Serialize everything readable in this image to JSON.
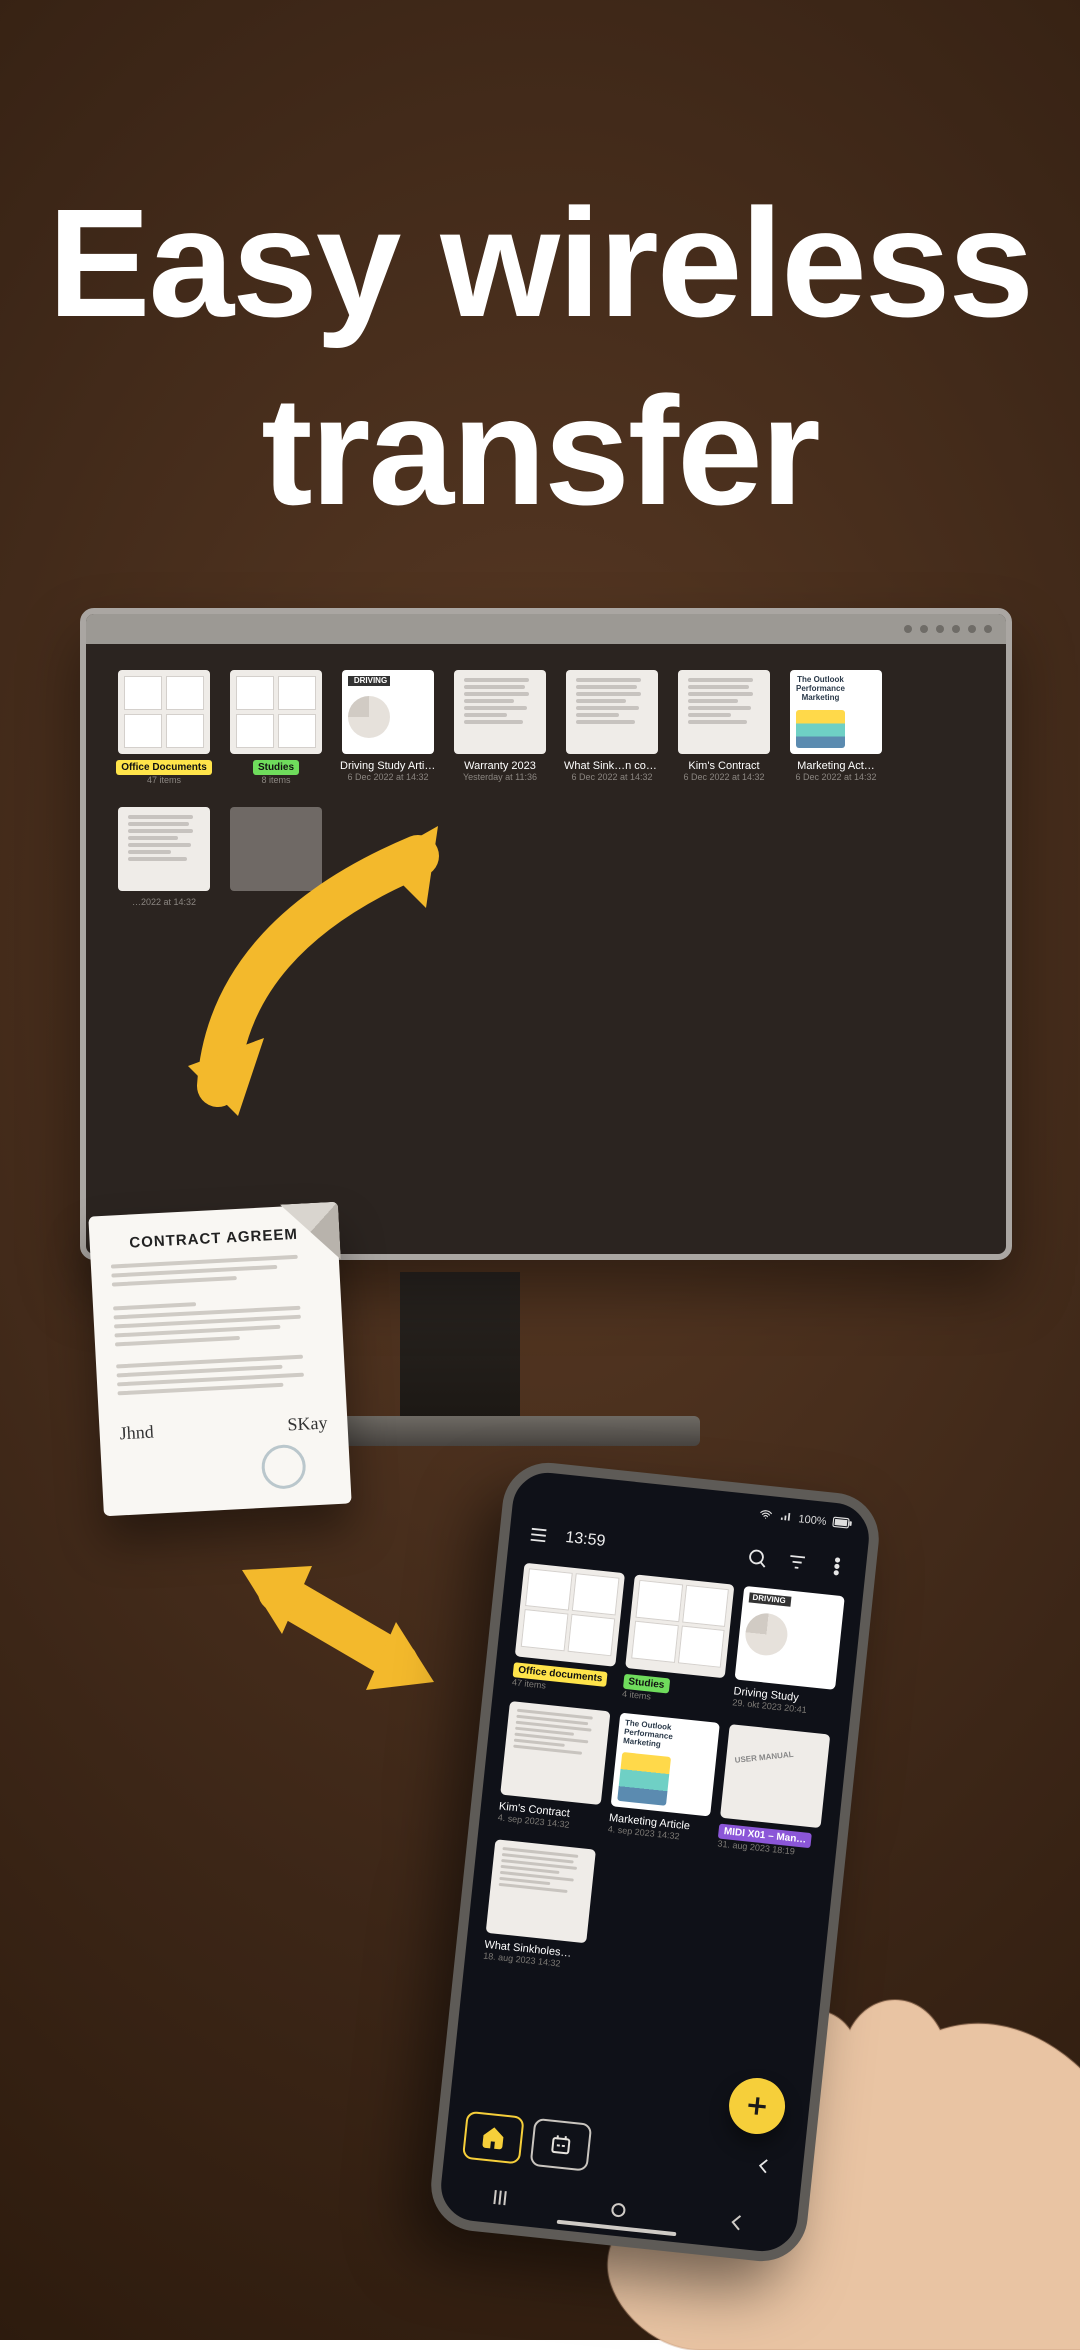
{
  "headline": "Easy wireless transfer",
  "accent_yellow": "#f6cf3a",
  "flying_doc": {
    "title": "CONTRACT AGREEM"
  },
  "monitor": {
    "items": [
      {
        "kind": "folder",
        "badge": "yellow",
        "badge_text": "Office Documents",
        "sub": "47 items"
      },
      {
        "kind": "folder",
        "badge": "green",
        "badge_text": "Studies",
        "sub": "8 items"
      },
      {
        "kind": "driving",
        "title": "Driving Study Article",
        "sub": "6 Dec 2022 at 14:32"
      },
      {
        "kind": "doc",
        "title": "Warranty 2023",
        "sub": "Yesterday at 11:36"
      },
      {
        "kind": "doc",
        "title": "What Sink…n common",
        "sub": "6 Dec 2022 at 14:32"
      },
      {
        "kind": "doc",
        "title": "Kim's Contract",
        "sub": "6 Dec 2022 at 14:32"
      },
      {
        "kind": "outlook",
        "title": "Marketing Act…",
        "sub": "6 Dec 2022 at 14:32"
      },
      {
        "kind": "doc",
        "title": "",
        "sub": "…2022 at 14:32"
      },
      {
        "kind": "blank",
        "title": "",
        "sub": ""
      }
    ]
  },
  "phone": {
    "status": {
      "signal": "100%",
      "battery_icon": "battery"
    },
    "time": "13:59",
    "toolbar_icons": [
      "search-icon",
      "filter-icon",
      "overflow-icon"
    ],
    "menu_icon": "menu-icon",
    "items": [
      {
        "kind": "folder",
        "badge": "yellow",
        "badge_text": "Office documents",
        "sub": "47 items"
      },
      {
        "kind": "folder",
        "badge": "green",
        "badge_text": "Studies",
        "sub": "4 items"
      },
      {
        "kind": "driving",
        "title": "Driving Study",
        "sub": "29. okt 2023 20:41"
      },
      {
        "kind": "doc",
        "title": "Kim's Contract",
        "sub": "4. sep 2023 14:32"
      },
      {
        "kind": "outlook",
        "title": "Marketing Article",
        "sub": "4. sep 2023 14:32"
      },
      {
        "kind": "doc",
        "badge": "purple",
        "badge_text": "MIDI X01 – Man…",
        "sub": "31. aug 2023 18:19",
        "overlay": "USER MANUAL"
      },
      {
        "kind": "doc",
        "title": "What Sinkholes…",
        "sub": "18. aug 2023 14:32"
      }
    ],
    "fab": "add-button",
    "bottom_tabs": [
      "home-icon",
      "library-icon"
    ],
    "nav_buttons": [
      "recent-apps",
      "home",
      "back"
    ]
  }
}
